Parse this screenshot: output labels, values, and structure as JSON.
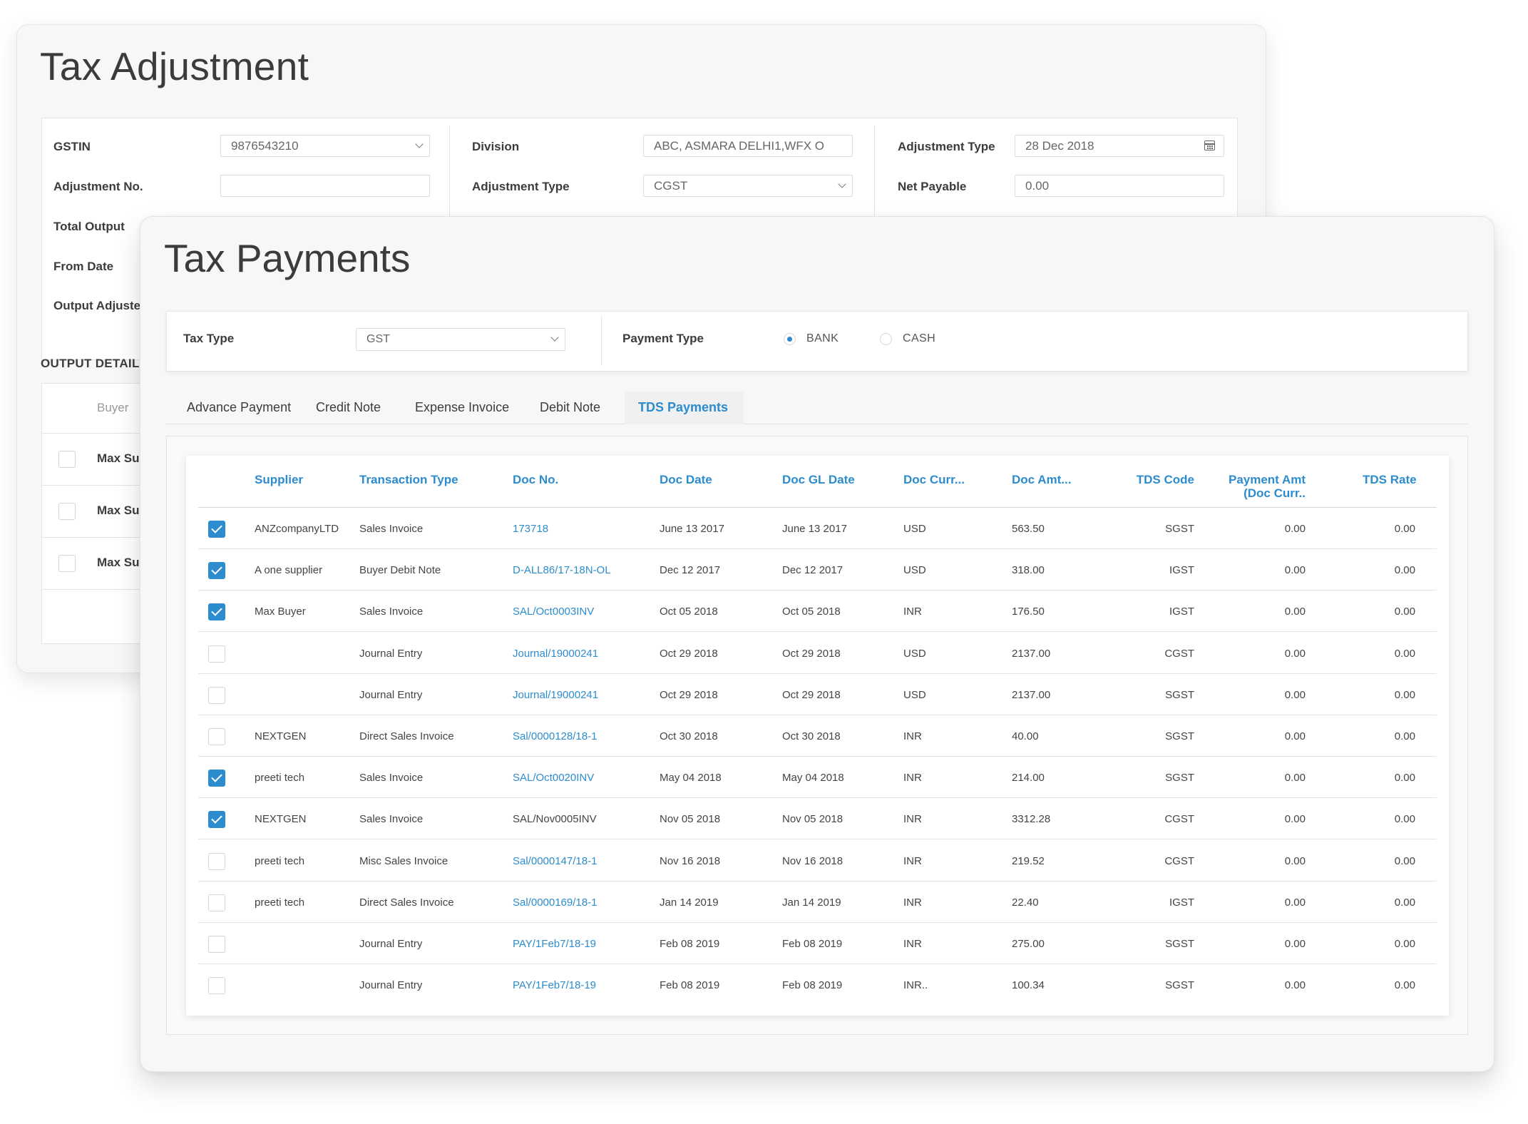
{
  "adjustment": {
    "title": "Tax Adjustment",
    "gstin_label": "GSTIN",
    "gstin_value": "9876543210",
    "adjustment_no_label": "Adjustment No.",
    "adjustment_no_value": "",
    "total_output_label": "Total Output",
    "from_date_label": "From Date",
    "output_adjust_label": "Output Adjuste",
    "division_label": "Division",
    "division_value": "ABC, ASMARA DELHI1,WFX O",
    "adjustment_type_label": "Adjustment Type",
    "adjustment_type_value": "CGST",
    "adjustment_type2_label": "Adjustment Type",
    "date_value": "28 Dec 2018",
    "net_payable_label": "Net Payable",
    "net_payable_value": "0.00",
    "output_details_heading": "OUTPUT DETAILS",
    "output_table_header": "Buyer",
    "output_rows": [
      "Max Su",
      "Max Su",
      "Max Su"
    ]
  },
  "payments": {
    "title": "Tax Payments",
    "tax_type_label": "Tax Type",
    "tax_type_value": "GST",
    "payment_type_label": "Payment Type",
    "radio_bank": "BANK",
    "radio_cash": "CASH",
    "selected_payment_type": "BANK",
    "tabs": [
      "Advance Payment",
      "Credit Note",
      "Expense Invoice",
      "Debit Note",
      "TDS Payments"
    ],
    "active_tab": "TDS Payments",
    "columns": [
      "Supplier",
      "Transaction Type",
      "Doc No.",
      "Doc Date",
      "Doc GL Date",
      "Doc Curr...",
      "Doc Amt...",
      "TDS Code",
      "Payment Amt",
      "(Doc Curr..",
      "TDS Rate"
    ],
    "rows": [
      {
        "checked": true,
        "supplier": "ANZcompanyLTD",
        "type": "Sales Invoice",
        "doc_no": "173718",
        "doc_link": true,
        "doc_date": "June 13 2017",
        "gl_date": "June 13 2017",
        "curr": "USD",
        "amt": "563.50",
        "tds": "SGST",
        "pay": "0.00",
        "rate": "0.00"
      },
      {
        "checked": true,
        "supplier": "A one supplier",
        "type": "Buyer Debit Note",
        "doc_no": "D-ALL86/17-18N-OL",
        "doc_link": true,
        "doc_date": "Dec 12 2017",
        "gl_date": "Dec 12 2017",
        "curr": "USD",
        "amt": "318.00",
        "tds": "IGST",
        "pay": "0.00",
        "rate": "0.00"
      },
      {
        "checked": true,
        "supplier": "Max Buyer",
        "type": "Sales Invoice",
        "doc_no": "SAL/Oct0003INV",
        "doc_link": true,
        "doc_date": "Oct 05 2018",
        "gl_date": "Oct 05 2018",
        "curr": "INR",
        "amt": "176.50",
        "tds": "IGST",
        "pay": "0.00",
        "rate": "0.00"
      },
      {
        "checked": false,
        "supplier": "",
        "type": "Journal Entry",
        "doc_no": "Journal/19000241",
        "doc_link": true,
        "doc_date": "Oct 29 2018",
        "gl_date": "Oct 29 2018",
        "curr": "USD",
        "amt": "2137.00",
        "tds": "CGST",
        "pay": "0.00",
        "rate": "0.00"
      },
      {
        "checked": false,
        "supplier": "",
        "type": "Journal Entry",
        "doc_no": "Journal/19000241",
        "doc_link": true,
        "doc_date": "Oct 29 2018",
        "gl_date": "Oct 29 2018",
        "curr": "USD",
        "amt": "2137.00",
        "tds": "SGST",
        "pay": "0.00",
        "rate": "0.00"
      },
      {
        "checked": false,
        "supplier": "NEXTGEN",
        "type": "Direct Sales Invoice",
        "doc_no": "Sal/0000128/18-1",
        "doc_link": true,
        "doc_date": "Oct 30 2018",
        "gl_date": "Oct 30 2018",
        "curr": "INR",
        "amt": "40.00",
        "tds": "SGST",
        "pay": "0.00",
        "rate": "0.00"
      },
      {
        "checked": true,
        "supplier": "preeti tech",
        "type": "Sales Invoice",
        "doc_no": "SAL/Oct0020INV",
        "doc_link": true,
        "doc_date": "May 04 2018",
        "gl_date": "May 04 2018",
        "curr": "INR",
        "amt": "214.00",
        "tds": "SGST",
        "pay": "0.00",
        "rate": "0.00"
      },
      {
        "checked": true,
        "supplier": "NEXTGEN",
        "type": "Sales Invoice",
        "doc_no": "SAL/Nov0005INV",
        "doc_link": false,
        "doc_date": "Nov 05 2018",
        "gl_date": "Nov 05 2018",
        "curr": "INR",
        "amt": "3312.28",
        "tds": "CGST",
        "pay": "0.00",
        "rate": "0.00"
      },
      {
        "checked": false,
        "supplier": "preeti tech",
        "type": "Misc Sales Invoice",
        "doc_no": "Sal/0000147/18-1",
        "doc_link": true,
        "doc_date": "Nov 16 2018",
        "gl_date": "Nov 16 2018",
        "curr": "INR",
        "amt": "219.52",
        "tds": "CGST",
        "pay": "0.00",
        "rate": "0.00"
      },
      {
        "checked": false,
        "supplier": "preeti tech",
        "type": "Direct Sales Invoice",
        "doc_no": "Sal/0000169/18-1",
        "doc_link": true,
        "doc_date": "Jan 14 2019",
        "gl_date": "Jan 14 2019",
        "curr": "INR",
        "amt": "22.40",
        "tds": "IGST",
        "pay": "0.00",
        "rate": "0.00"
      },
      {
        "checked": false,
        "supplier": "",
        "type": "Journal Entry",
        "doc_no": "PAY/1Feb7/18-19",
        "doc_link": true,
        "doc_date": "Feb 08 2019",
        "gl_date": "Feb 08 2019",
        "curr": "INR",
        "amt": "275.00",
        "tds": "SGST",
        "pay": "0.00",
        "rate": "0.00"
      },
      {
        "checked": false,
        "supplier": "",
        "type": "Journal Entry",
        "doc_no": "PAY/1Feb7/18-19",
        "doc_link": true,
        "doc_date": "Feb 08 2019",
        "gl_date": "Feb 08 2019",
        "curr": "INR..",
        "amt": "100.34",
        "tds": "SGST",
        "pay": "0.00",
        "rate": "0.00"
      }
    ]
  },
  "colors": {
    "accent": "#2d8ccd",
    "card_bg": "#f7f7f7",
    "text": "#3c3c3c"
  }
}
